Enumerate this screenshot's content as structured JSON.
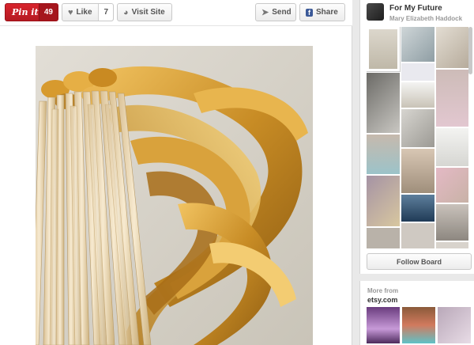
{
  "toolbar": {
    "pinit_label": "Pin it",
    "pinit_count": "49",
    "like_label": "Like",
    "like_count": "7",
    "visit_label": "Visit Site",
    "send_label": "Send",
    "share_label": "Share"
  },
  "board": {
    "title": "For My Future",
    "owner": "Mary Elizabeth Haddock",
    "follow_label": "Follow Board"
  },
  "more": {
    "label": "More from",
    "site": "etsy.com"
  },
  "colors": {
    "pinit": "#cb2027",
    "ribbon_gold": "#c9922a",
    "wood": "#ead9b4"
  }
}
